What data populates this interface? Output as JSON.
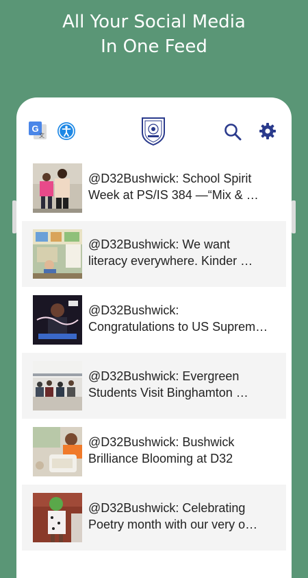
{
  "headline": {
    "line1": "All Your Social Media",
    "line2": "In One Feed"
  },
  "toolbar": {
    "left_icons": [
      "translate-icon",
      "accessibility-icon"
    ],
    "logo": "school-crest-logo",
    "right_icons": [
      "search-icon",
      "gear-icon"
    ],
    "accent_color": "#2a3a8c"
  },
  "feed": {
    "items": [
      {
        "line1": "@D32Bushwick: School Spirit",
        "line2": "Week at PS/IS 384 —“Mix & …"
      },
      {
        "line1": "@D32Bushwick: We want",
        "line2": "literacy everywhere. Kinder …"
      },
      {
        "line1": "@D32Bushwick:",
        "line2": "Congratulations to US Suprem…"
      },
      {
        "line1": "@D32Bushwick: Evergreen",
        "line2": "Students Visit Binghamton …"
      },
      {
        "line1": "@D32Bushwick: Bushwick",
        "line2": "Brilliance Blooming at D32"
      },
      {
        "line1": "@D32Bushwick: Celebrating",
        "line2": "Poetry month with our very o…"
      }
    ]
  },
  "colors": {
    "background": "#5a9676",
    "card": "#ffffff",
    "alt_row": "#f4f4f4"
  }
}
